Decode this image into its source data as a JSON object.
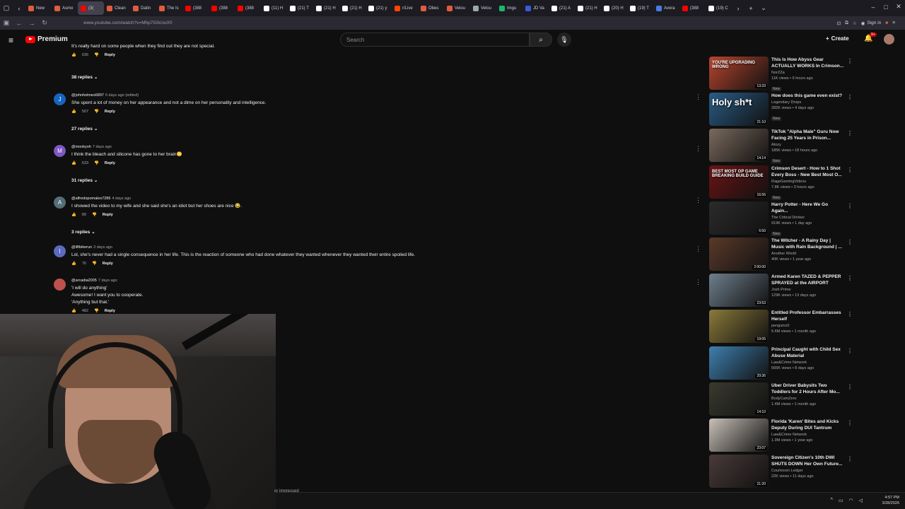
{
  "browser": {
    "tabs": [
      {
        "label": "New",
        "color": "#e25c3c"
      },
      {
        "label": "Asmo",
        "color": "#e25c3c"
      },
      {
        "label": "(3(",
        "color": "#ff0000",
        "active": true
      },
      {
        "label": "Clean",
        "color": "#e25c3c"
      },
      {
        "label": "Datin",
        "color": "#e25c3c"
      },
      {
        "label": "The Is",
        "color": "#e25c3c"
      },
      {
        "label": "(388",
        "color": "#ff0000"
      },
      {
        "label": "(388",
        "color": "#ff0000"
      },
      {
        "label": "(388",
        "color": "#ff0000"
      },
      {
        "label": "(11) H",
        "color": "#ffffff"
      },
      {
        "label": "(21) T",
        "color": "#ffffff"
      },
      {
        "label": "(21) H",
        "color": "#ffffff"
      },
      {
        "label": "(21) H",
        "color": "#ffffff"
      },
      {
        "label": "(21) y",
        "color": "#ffffff"
      },
      {
        "label": "r/Live",
        "color": "#ff4500"
      },
      {
        "label": "Obes",
        "color": "#e25c3c"
      },
      {
        "label": "Velou",
        "color": "#e25c3c"
      },
      {
        "label": "Velou",
        "color": "#9aa"
      },
      {
        "label": "Imgu",
        "color": "#1bb76e"
      },
      {
        "label": "JD Va",
        "color": "#3b5bdb"
      },
      {
        "label": "(21) A",
        "color": "#ffffff"
      },
      {
        "label": "(21) H",
        "color": "#ffffff"
      },
      {
        "label": "(20) H",
        "color": "#ffffff"
      },
      {
        "label": "(19) T",
        "color": "#ffffff"
      },
      {
        "label": "Avera",
        "color": "#4a7be0"
      },
      {
        "label": "(388",
        "color": "#ff0000"
      },
      {
        "label": "(19) C",
        "color": "#ffffff"
      }
    ],
    "url": "www.youtube.com/watch?v=Mhp7G0cnoX0",
    "sign_in": "Sign in"
  },
  "header": {
    "logo": "Premium",
    "search_placeholder": "Search",
    "create": "Create",
    "notif_badge": "9+"
  },
  "comments": [
    {
      "text": "It's really hard on some people when they find out they are not special.",
      "likes": "636",
      "reply": "Reply",
      "replies": "38 replies",
      "partial": true
    },
    {
      "user": "@johnholmes6897",
      "time": "6 days ago (edited)",
      "text": "She spent a lot of money on her appearance and not a dime on her personality and intelligence.",
      "likes": "507",
      "reply": "Reply",
      "replies": "27 replies",
      "avatar_letter": "J",
      "avatar_color": "#1565c0"
    },
    {
      "user": "@mookyoh",
      "time": "7 days ago",
      "text": "I think the bleach and silicone has gone to her brain😳",
      "likes": "633",
      "reply": "Reply",
      "replies": "31 replies",
      "avatar_letter": "M",
      "avatar_color": "#7e57c2"
    },
    {
      "user": "@alfredopomales7286",
      "time": "4 days ago",
      "text": "I showed the video to my wife and she said she's an idiot but her shoes are nice 😂.",
      "likes": "89",
      "reply": "Reply",
      "replies": "3 replies",
      "avatar_letter": "A",
      "avatar_color": "#546e7a"
    },
    {
      "user": "@liftbikerun",
      "time": "3 days ago",
      "text": "Lol, she's never had a single consequence in her life.  This is the reaction of someone who had done whatever they wanted whenever they wanted their entire spoiled life.",
      "likes": "76",
      "reply": "Reply",
      "avatar_letter": "l",
      "avatar_color": "#5c6bc0"
    },
    {
      "user": "@arcadia2005",
      "time": "7 days ago",
      "text_lines": [
        "'I will do anything'",
        "Awesome! I want you to cooperate.",
        "'Anything but that.'"
      ],
      "likes": "482",
      "reply": "Reply",
      "avatar_color": "#c0504d"
    }
  ],
  "recommendations": [
    {
      "title": "This Is How Abyss Gear ACTUALLY WORKS In Crimson...",
      "channel": "NorZZa",
      "meta": "11K views • 6 hours ago",
      "new": "New",
      "duration": "13:33",
      "thumb_color": "#b8452e",
      "thumb_text": "YOU'RE UPGRADING WRONG"
    },
    {
      "title": "How does this game even exist?",
      "channel": "Legendary Drops",
      "meta": "282K views • 4 days ago",
      "new": "New",
      "duration": "21:10",
      "thumb_color": "#2a5c86",
      "thumb_text": "Holy sh*t"
    },
    {
      "title": "TikTok \"Alpha Male\" Guru Now Facing 25 Years in Prison...",
      "channel": "Atozy",
      "meta": "185K views • 18 hours ago",
      "new": "New",
      "duration": "14:14",
      "thumb_color": "#7a6a5e",
      "thumb_text": ""
    },
    {
      "title": "Crimson Desert - How to 1 Shot Every Boss - New Best Most O...",
      "channel": "RageGamingVideos",
      "meta": "7.8K views • 3 hours ago",
      "new": "New",
      "duration": "16:56",
      "thumb_color": "#6b1414",
      "thumb_text": "BEST MOST OP GAME BREAKING BUILD GUIDE"
    },
    {
      "title": "Harry Potter - Here We Go Again...",
      "channel": "The Critical Drinker",
      "meta": "919K views • 1 day ago",
      "new": "New",
      "duration": "6:50",
      "thumb_color": "#2b2b2b",
      "thumb_text": ""
    },
    {
      "title": "The Witcher - A Rainy Day | Music with Rain Background | ...",
      "channel": "Another World",
      "meta": "40K views • 1 year ago",
      "duration": "2:00:00",
      "thumb_color": "#5a3a2a",
      "thumb_text": ""
    },
    {
      "title": "Armed Karen TAZED & PEPPER SPRAYED at the AIRPORT",
      "channel": "Josh Prime",
      "meta": "129K views • 13 days ago",
      "duration": "23:53",
      "thumb_color": "#6e7f8c",
      "thumb_text": ""
    },
    {
      "title": "Entitled Professor Embarrasses Herself",
      "channel": "penguinz0",
      "meta": "5.6M views • 1 month ago",
      "duration": "19:05",
      "thumb_color": "#8a7a3a",
      "thumb_text": ""
    },
    {
      "title": "Principal Caught with Child Sex Abuse Material",
      "channel": "Law&Crime Network",
      "meta": "565K views • 8 days ago",
      "duration": "29:36",
      "thumb_color": "#3f7fae",
      "thumb_text": ""
    },
    {
      "title": "Uber Driver Babysits Two Toddlers for 2 Hours After Mo...",
      "channel": "BodyCamZero",
      "meta": "1.4M views • 1 month ago",
      "duration": "14:10",
      "thumb_color": "#3a3a30",
      "thumb_text": ""
    },
    {
      "title": "Florida 'Karen' Bites and Kicks Deputy During DUI Tantrum",
      "channel": "Law&Crime Network",
      "meta": "1.9M views • 1 year ago",
      "duration": "23:07",
      "thumb_color": "#c8c0b8",
      "thumb_text": ""
    },
    {
      "title": "Sovereign Citizen's 10th DWI SHUTS DOWN Her Own Future...",
      "channel": "Courtroom Ledger",
      "meta": "22K views • 11 days ago",
      "duration": "21:20",
      "thumb_color": "#4a3a3a",
      "thumb_text": ""
    }
  ],
  "partial_text": "or impressed",
  "taskbar": {
    "time": "4:57 PM",
    "date": "3/28/2026"
  },
  "icons": [
    "hamburger-icon",
    "search-icon",
    "mic-icon",
    "bell-icon",
    "plus-icon",
    "more-vert-icon",
    "like-icon",
    "dislike-icon",
    "chevron-down-icon"
  ]
}
